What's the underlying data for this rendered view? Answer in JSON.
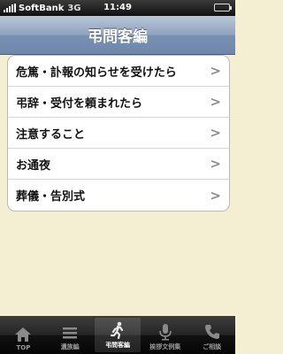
{
  "status": {
    "carrier": "SoftBank",
    "network": "3G",
    "time": "11:49"
  },
  "nav": {
    "title": "弔問客編"
  },
  "menu": [
    {
      "label": "危篤・訃報の知らせを受けたら"
    },
    {
      "label": "弔辞・受付を頼まれたら"
    },
    {
      "label": "注意すること"
    },
    {
      "label": "お通夜"
    },
    {
      "label": "葬儀・告別式"
    }
  ],
  "tabs": [
    {
      "label": "TOP",
      "icon": "home-icon"
    },
    {
      "label": "遺族編",
      "icon": "list-icon"
    },
    {
      "label": "弔問客編",
      "icon": "walking-person-icon"
    },
    {
      "label": "挨拶文例集",
      "icon": "microphone-icon"
    },
    {
      "label": "ご相談",
      "icon": "phone-icon"
    }
  ],
  "colors": {
    "accent_nav": "#7890b2",
    "background": "#f4eed3",
    "battery": "#5cd65c"
  }
}
